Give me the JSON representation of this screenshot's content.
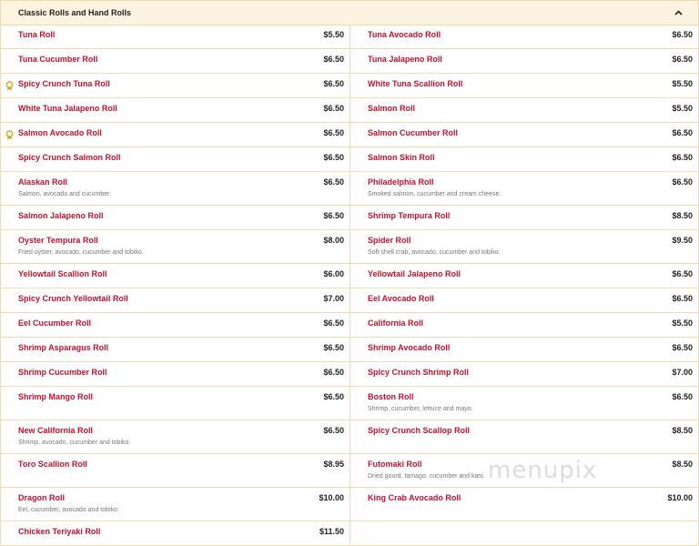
{
  "section": {
    "title": "Classic Rolls and Hand Rolls"
  },
  "watermark": "menupix",
  "left": [
    {
      "name": "Tuna Roll",
      "price": "$5.50",
      "desc": "",
      "badge": false,
      "h": 27
    },
    {
      "name": "Tuna Cucumber Roll",
      "price": "$6.50",
      "desc": "",
      "badge": false,
      "h": 27
    },
    {
      "name": "Spicy Crunch Tuna Roll",
      "price": "$6.50",
      "desc": "",
      "badge": true,
      "h": 27
    },
    {
      "name": "White Tuna Jalapeno Roll",
      "price": "$6.50",
      "desc": "",
      "badge": false,
      "h": 27
    },
    {
      "name": "Salmon Avocado Roll",
      "price": "$6.50",
      "desc": "",
      "badge": true,
      "h": 27
    },
    {
      "name": "Spicy Crunch Salmon Roll",
      "price": "$6.50",
      "desc": "",
      "badge": false,
      "h": 27
    },
    {
      "name": "Alaskan Roll",
      "price": "$6.50",
      "desc": "Salmon, avocado and cucumber.",
      "badge": false,
      "h": 37
    },
    {
      "name": "Salmon Jalapeno Roll",
      "price": "$6.50",
      "desc": "",
      "badge": false,
      "h": 27
    },
    {
      "name": "Oyster Tempura Roll",
      "price": "$8.00",
      "desc": "Fried oyster, avocado, cucumber and tobiko.",
      "badge": false,
      "h": 37
    },
    {
      "name": "Yellowtail Scallion Roll",
      "price": "$6.00",
      "desc": "",
      "badge": false,
      "h": 27
    },
    {
      "name": "Spicy Crunch Yellowtail Roll",
      "price": "$7.00",
      "desc": "",
      "badge": false,
      "h": 27
    },
    {
      "name": "Eel Cucumber Roll",
      "price": "$6.50",
      "desc": "",
      "badge": false,
      "h": 27
    },
    {
      "name": "Shrimp Asparagus Roll",
      "price": "$6.50",
      "desc": "",
      "badge": false,
      "h": 27
    },
    {
      "name": "Shrimp Cucumber Roll",
      "price": "$6.50",
      "desc": "",
      "badge": false,
      "h": 27
    },
    {
      "name": "Shrimp Mango Roll",
      "price": "$6.50",
      "desc": "",
      "badge": false,
      "h": 37
    },
    {
      "name": "New California Roll",
      "price": "$6.50",
      "desc": "Shrimp, avocado, cucumber and tobiko.",
      "badge": false,
      "h": 37
    },
    {
      "name": "Toro Scallion Roll",
      "price": "$8.95",
      "desc": "",
      "badge": false,
      "h": 37
    },
    {
      "name": "Dragon Roll",
      "price": "$10.00",
      "desc": "Eel, cucumber, avocado and tobiko.",
      "badge": false,
      "h": 37
    },
    {
      "name": "Chicken Teriyaki Roll",
      "price": "$11.50",
      "desc": "",
      "badge": false,
      "h": 27
    }
  ],
  "right": [
    {
      "name": "Tuna Avocado Roll",
      "price": "$6.50",
      "desc": "",
      "h": 27
    },
    {
      "name": "Tuna Jalapeno Roll",
      "price": "$6.50",
      "desc": "",
      "h": 27
    },
    {
      "name": "White Tuna Scallion Roll",
      "price": "$5.50",
      "desc": "",
      "h": 27
    },
    {
      "name": "Salmon Roll",
      "price": "$5.50",
      "desc": "",
      "h": 27
    },
    {
      "name": "Salmon Cucumber Roll",
      "price": "$6.50",
      "desc": "",
      "h": 27
    },
    {
      "name": "Salmon Skin Roll",
      "price": "$6.50",
      "desc": "",
      "h": 27
    },
    {
      "name": "Philadelphia Roll",
      "price": "$6.50",
      "desc": "Smoked salmon, cucumber and cream cheese.",
      "h": 37
    },
    {
      "name": "Shrimp Tempura Roll",
      "price": "$8.50",
      "desc": "",
      "h": 27
    },
    {
      "name": "Spider Roll",
      "price": "$9.50",
      "desc": "Soft shell crab, avocado, cucumber and tobiko.",
      "h": 37
    },
    {
      "name": "Yellowtail Jalapeno Roll",
      "price": "$6.50",
      "desc": "",
      "h": 27
    },
    {
      "name": "Eel Avocado Roll",
      "price": "$6.50",
      "desc": "",
      "h": 27
    },
    {
      "name": "California Roll",
      "price": "$5.50",
      "desc": "",
      "h": 27
    },
    {
      "name": "Shrimp Avocado Roll",
      "price": "$6.50",
      "desc": "",
      "h": 27
    },
    {
      "name": "Spicy Crunch Shrimp Roll",
      "price": "$7.00",
      "desc": "",
      "h": 27
    },
    {
      "name": "Boston Roll",
      "price": "$6.50",
      "desc": "Shrimp, cucumber, lettuce and mayo.",
      "h": 37
    },
    {
      "name": "Spicy Crunch Scallop Roll",
      "price": "$8.50",
      "desc": "",
      "h": 37
    },
    {
      "name": "Futomaki Roll",
      "price": "$8.50",
      "desc": "Dried gourd, tamago, cucumber and kani.",
      "h": 37
    },
    {
      "name": "King Crab Avocado Roll",
      "price": "$10.00",
      "desc": "",
      "h": 37
    },
    {
      "name": "",
      "price": "",
      "desc": "",
      "h": 27
    }
  ]
}
